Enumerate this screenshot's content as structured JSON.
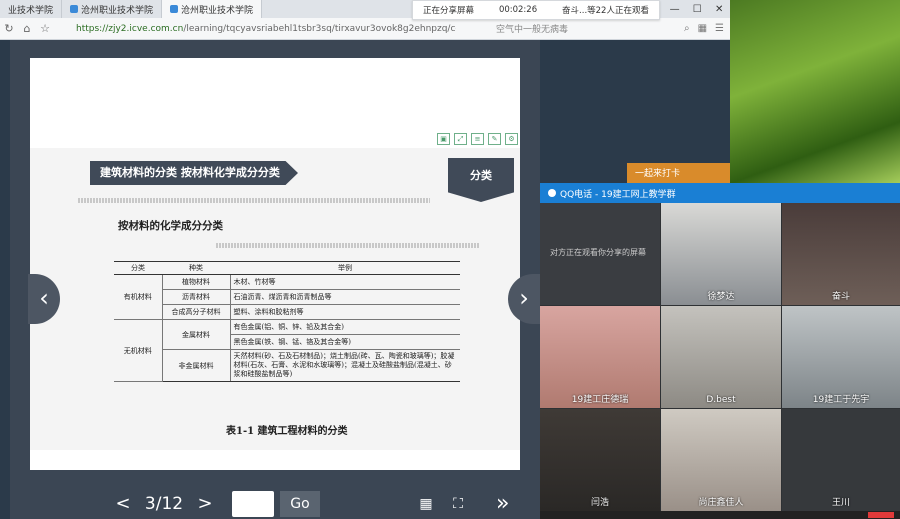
{
  "browser": {
    "tabs": [
      "业技术学院",
      "沧州职业技术学院",
      "沧州职业技术学院"
    ],
    "url_host": "https://zjy2.icve.com.cn",
    "url_path": "/learning/tqcyavsriabehl1tsbr3sq/tirxavur3ovok8g2ehnpzq/cours",
    "search_hint": "空气中一般无病毒",
    "window_controls": [
      "—",
      "☐",
      "✕"
    ]
  },
  "sharebar": {
    "status": "正在分享屏幕",
    "time": "00:02:26",
    "viewers": "奋斗...等22人正在观看"
  },
  "slide": {
    "title": "建筑材料的分类  按材料化学成分分类",
    "tag": "分类",
    "section": "按材料的化学成分分类",
    "headers": [
      "分类",
      "种类",
      "举例"
    ],
    "rows": {
      "organic": "有机材料",
      "inorganic": "无机材料",
      "plant": "植物材料",
      "plant_ex": "木材、竹材等",
      "asphalt": "沥青材料",
      "asphalt_ex": "石油沥青、煤沥青和沥青制品等",
      "polymer": "合成高分子材料",
      "polymer_ex": "塑料、涂料和胶粘剂等",
      "metal": "金属材料",
      "metal_ex1": "有色金属(铝、铜、锌、铅及其合金)",
      "metal_ex2": "黑色金属(铁、钢、锰、铬及其合金等)",
      "nonmetal": "非金属材料",
      "nonmetal_ex": "天然材料(砂、石及石材制品)；烧土制品(砖、瓦、陶瓷和玻璃等)；胶凝材料(石灰、石膏、水泥和水玻璃等)；混凝土及硅酸盐制品(混凝土、砂浆和硅酸盐制品等)"
    },
    "caption": "表1-1   建筑工程材料的分类"
  },
  "pager": {
    "prev": "<",
    "page": "3/12",
    "next": ">",
    "go": "Go",
    "last": "»"
  },
  "desktop": {
    "orange_text": "一起来打卡"
  },
  "qq": {
    "title": "QQ电话 - 19建工网上教学群",
    "note": "对方正在观看你分享的屏幕",
    "participants": [
      "徐梦达",
      "奋斗",
      "19建工庄德瑞",
      "D.best",
      "19建工于先宇",
      "闫浩",
      "尚庄鑫佳人",
      "王川"
    ]
  }
}
